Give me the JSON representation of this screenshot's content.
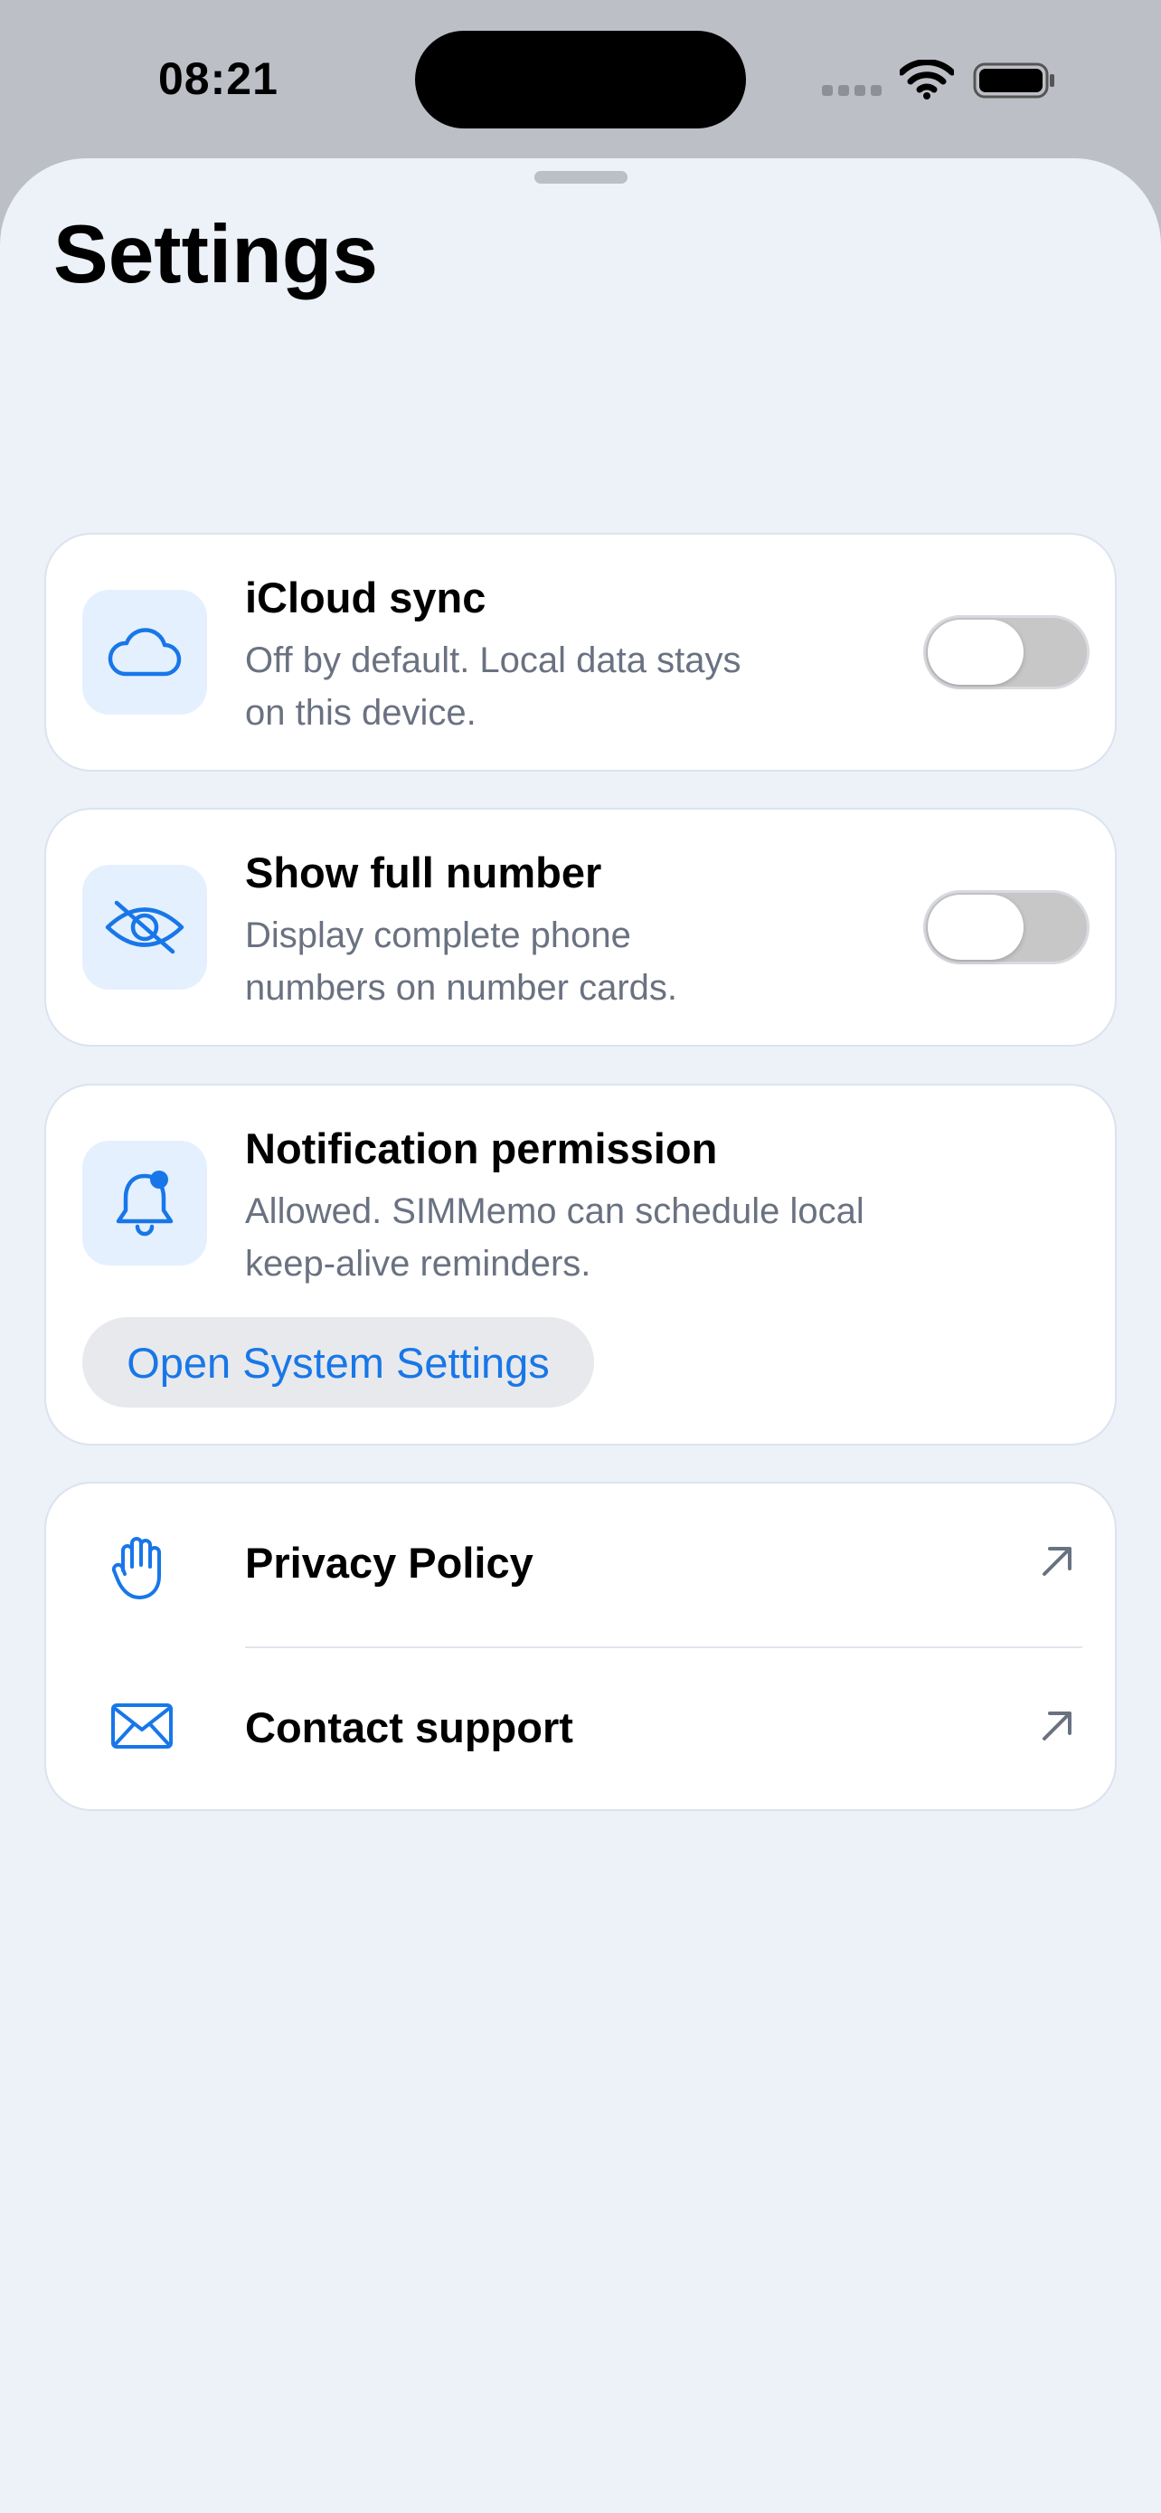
{
  "status_bar": {
    "time": "08:21"
  },
  "page": {
    "title": "Settings"
  },
  "settings": {
    "icloud": {
      "title": "iCloud sync",
      "desc_line1": "Off by default. Local data stays",
      "desc_line2": "on this device.",
      "icon": "cloud-icon",
      "enabled": false
    },
    "full_number": {
      "title": "Show full number",
      "desc_line1": "Display complete phone",
      "desc_line2": "numbers on number cards.",
      "icon": "eye-slash-icon",
      "enabled": false
    },
    "notifications": {
      "title": "Notification permission",
      "desc_line1": "Allowed. SIMMemo can schedule local",
      "desc_line2": "keep-alive reminders.",
      "icon": "bell-badge-icon",
      "button_label": "Open System Settings"
    }
  },
  "links": [
    {
      "label": "Privacy Policy",
      "icon": "hand-raised-icon",
      "trailing_icon": "arrow-up-right-icon"
    },
    {
      "label": "Contact support",
      "icon": "envelope-icon",
      "trailing_icon": "arrow-up-right-icon"
    }
  ],
  "colors": {
    "accent": "#1877e8",
    "sheet_background": "#edf1f8",
    "card_background": "#ffffff",
    "icon_tile": "#e5f0ff",
    "secondary_text": "#6a7281",
    "toggle_off": "#c7c7c7"
  }
}
